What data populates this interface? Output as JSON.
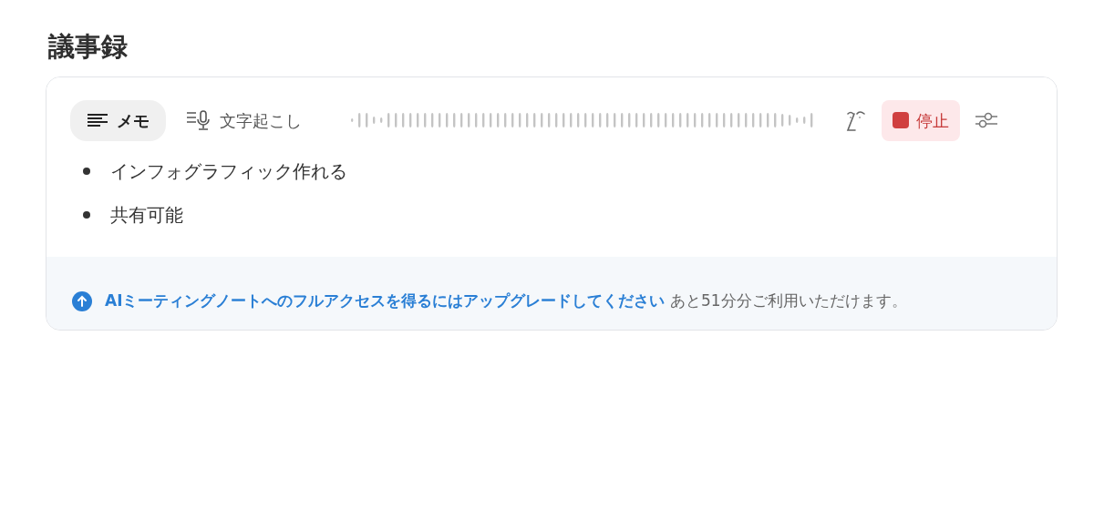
{
  "title": "議事録",
  "tabs": [
    {
      "label": "メモ",
      "selected": true
    },
    {
      "label": "文字起こし",
      "selected": false
    }
  ],
  "stop_button": {
    "label": "停止"
  },
  "notes": [
    "インフォグラフィック作れる",
    "共有可能"
  ],
  "notice": {
    "link": "AIミーティングノートへのフルアクセスを得るにはアップグレードしてください",
    "text": " あと51分分ご利用いただけます。"
  }
}
